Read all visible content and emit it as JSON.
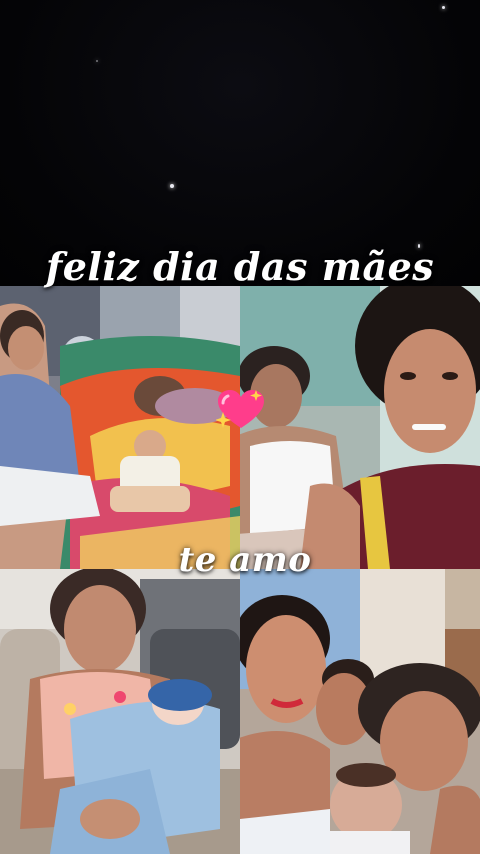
{
  "captions": {
    "top": "feliz dia das mães",
    "middle": "te amo"
  },
  "decorations": {
    "sparkle_heart": "sparkling-heart-emoji"
  },
  "colors": {
    "background": "#050507",
    "caption_text": "#ffffff",
    "heart": "#ff3d8b"
  }
}
